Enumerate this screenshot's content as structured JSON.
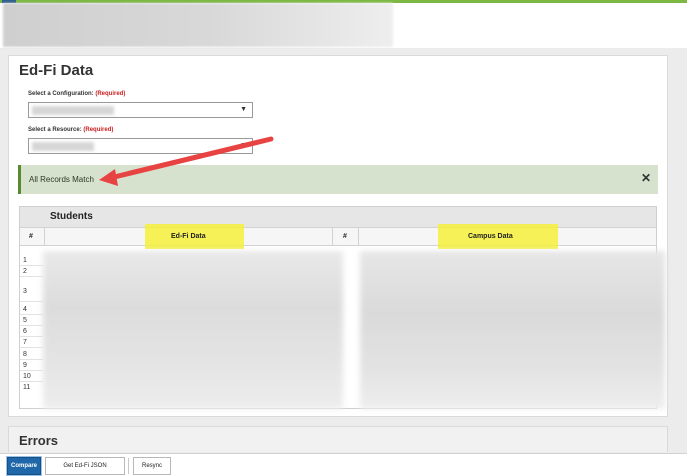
{
  "panel": {
    "title": "Ed-Fi Data"
  },
  "form": {
    "configuration": {
      "label": "Select a Configuration:",
      "required": "(Required)",
      "arrow": "▼"
    },
    "resource": {
      "label": "Select a Resource:",
      "required": "(Required)",
      "arrow": "▼"
    }
  },
  "alert": {
    "message": "All Records Match",
    "close": "✕"
  },
  "table": {
    "title": "Students",
    "columns": {
      "num_left": "#",
      "edfi": "Ed-Fi Data",
      "num_right": "#",
      "campus": "Campus Data"
    },
    "rows": [
      "1",
      "2",
      "3",
      "4",
      "5",
      "6",
      "7",
      "8",
      "9",
      "10",
      "11"
    ]
  },
  "errors": {
    "title": "Errors"
  },
  "footer": {
    "compare": "Compare",
    "get_json": "Get Ed-Fi JSON",
    "resync": "Resync"
  },
  "colors": {
    "accent_green": "#7cb843",
    "alert_bg": "#d6e2cd",
    "highlight_yellow": "#f4f03a",
    "primary_blue": "#1f67a8",
    "annotation_red": "#e84343"
  },
  "icons": {
    "cursor": "mouse-pointer-icon",
    "close": "close-icon",
    "dropdown": "chevron-down-icon",
    "annotation": "red-arrow-annotation"
  }
}
